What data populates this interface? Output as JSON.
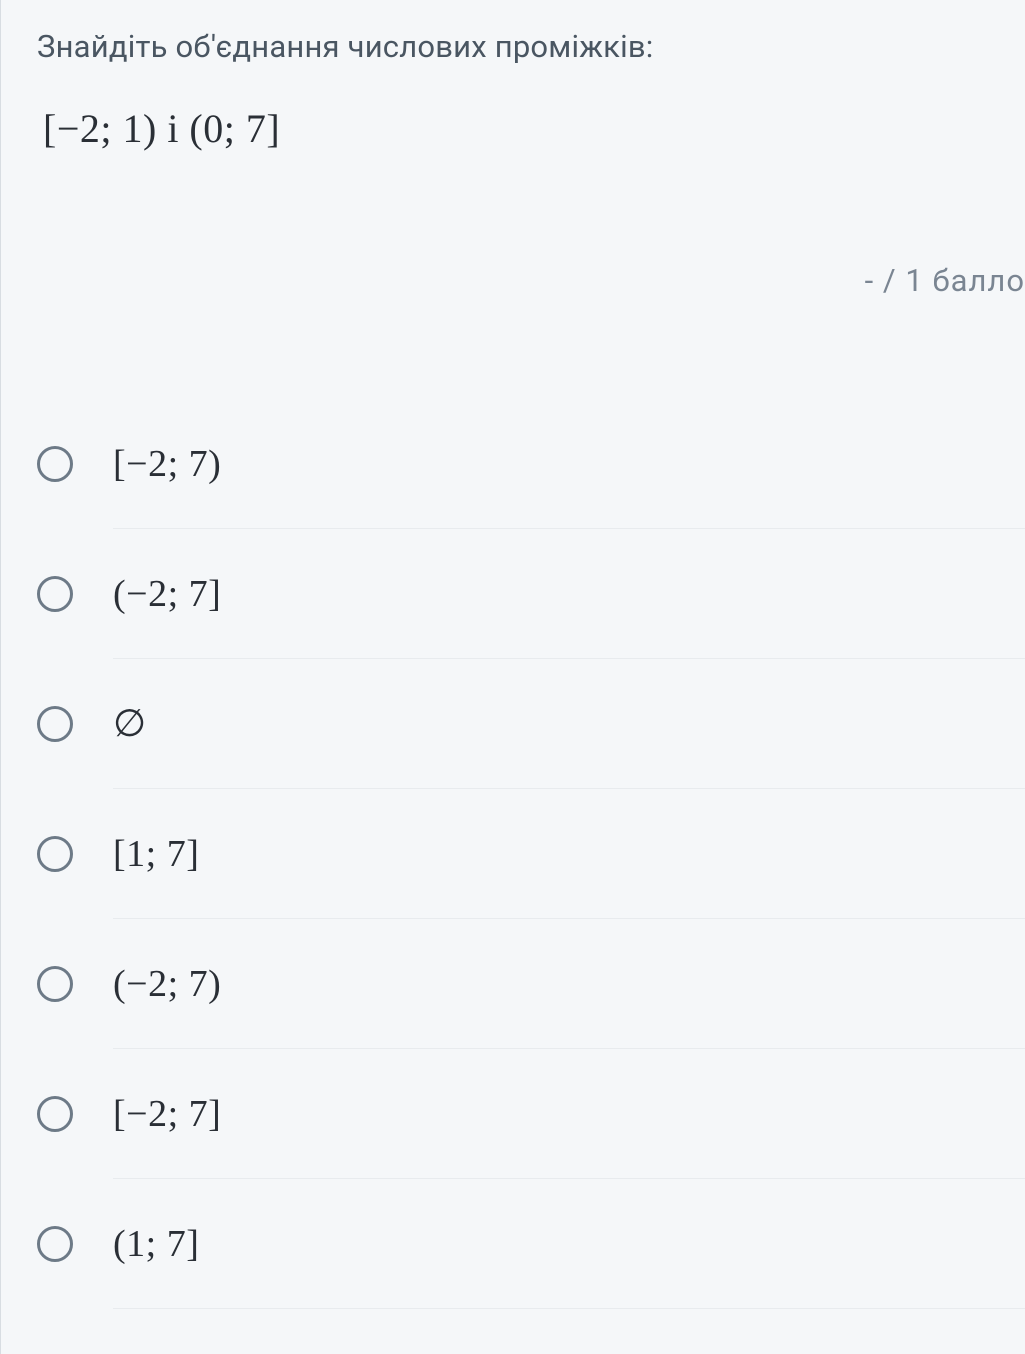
{
  "question": {
    "prompt": "Знайдіть об'єднання числових проміжків:",
    "expression": "[−2; 1) і (0; 7]"
  },
  "score": {
    "display": "-  /  1  балло"
  },
  "options": [
    {
      "label": "[−2; 7)"
    },
    {
      "label": "(−2; 7]"
    },
    {
      "label": "∅"
    },
    {
      "label": "[1; 7]"
    },
    {
      "label": "(−2; 7)"
    },
    {
      "label": "[−2; 7]"
    },
    {
      "label": "(1; 7]"
    }
  ]
}
